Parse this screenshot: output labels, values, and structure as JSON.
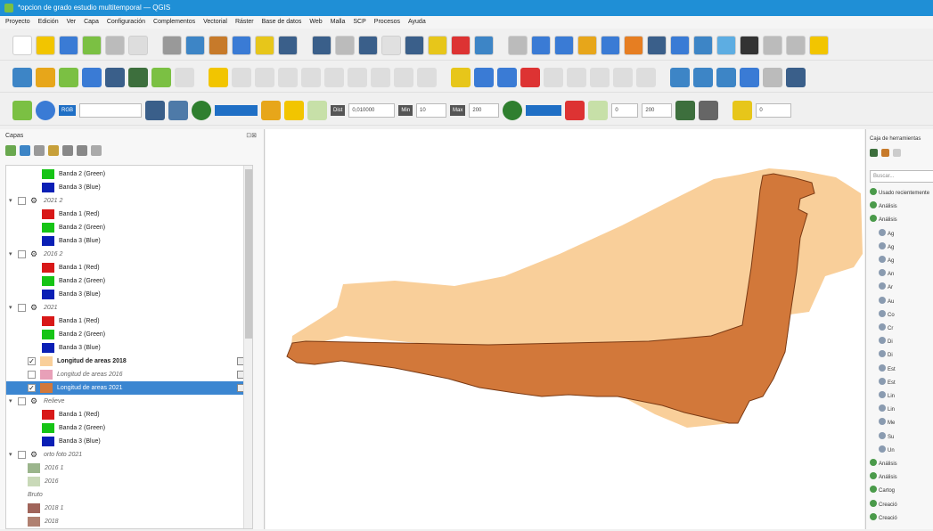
{
  "window": {
    "title": "*opcion de grado estudio multitemporal — QGIS"
  },
  "menu": [
    "Proyecto",
    "Edición",
    "Ver",
    "Capa",
    "Configuración",
    "Complementos",
    "Vectorial",
    "Ráster",
    "Base de datos",
    "Web",
    "Malla",
    "SCP",
    "Procesos",
    "Ayuda"
  ],
  "toolbar3": {
    "rgb_tag": "RGB",
    "value1": "0,010000",
    "value2": "10",
    "value3": "200",
    "value4": "0",
    "value5": "200",
    "value6": "0"
  },
  "layers_panel": {
    "title": "Capas",
    "rows": [
      {
        "type": "band",
        "label": "Banda 2 (Green)",
        "color": "#16c416"
      },
      {
        "type": "band",
        "label": "Banda 3 (Blue)",
        "color": "#0a1fb5"
      },
      {
        "type": "group",
        "label": "2021 2"
      },
      {
        "type": "band",
        "label": "Banda 1 (Red)",
        "color": "#d81818"
      },
      {
        "type": "band",
        "label": "Banda 2 (Green)",
        "color": "#16c416"
      },
      {
        "type": "band",
        "label": "Banda 3 (Blue)",
        "color": "#0a1fb5"
      },
      {
        "type": "group",
        "label": "2016 2"
      },
      {
        "type": "band",
        "label": "Banda 1 (Red)",
        "color": "#d81818"
      },
      {
        "type": "band",
        "label": "Banda 2 (Green)",
        "color": "#16c416"
      },
      {
        "type": "band",
        "label": "Banda 3 (Blue)",
        "color": "#0a1fb5"
      },
      {
        "type": "group",
        "label": "2021"
      },
      {
        "type": "band",
        "label": "Banda 1 (Red)",
        "color": "#d81818"
      },
      {
        "type": "band",
        "label": "Banda 2 (Green)",
        "color": "#16c416"
      },
      {
        "type": "band",
        "label": "Banda 3 (Blue)",
        "color": "#0a1fb5"
      },
      {
        "type": "vector",
        "label": "Longitud de areas 2018",
        "color": "#f9cf9a",
        "checked": true,
        "bold": true
      },
      {
        "type": "vector",
        "label": "Longitud de areas 2016",
        "color": "#e8a0b8",
        "checked": false,
        "italic": true
      },
      {
        "type": "vector",
        "label": "Longitud de areas 2021",
        "color": "#d2783a",
        "checked": true,
        "selected": true
      },
      {
        "type": "group",
        "label": "Relieve"
      },
      {
        "type": "band",
        "label": "Banda 1 (Red)",
        "color": "#d81818"
      },
      {
        "type": "band",
        "label": "Banda 2 (Green)",
        "color": "#16c416"
      },
      {
        "type": "band",
        "label": "Banda 3 (Blue)",
        "color": "#0a1fb5"
      },
      {
        "type": "group",
        "label": "orto foto 2021"
      },
      {
        "type": "swatch",
        "label": "2016 1",
        "color": "#9bb58c"
      },
      {
        "type": "swatch",
        "label": "2016",
        "color": "#c9d9b8"
      },
      {
        "type": "plain",
        "label": "Bruto"
      },
      {
        "type": "swatch",
        "label": "2018 1",
        "color": "#a0645a"
      },
      {
        "type": "swatch",
        "label": "2018",
        "color": "#b08070"
      }
    ]
  },
  "toolbox": {
    "title": "Caja de herramientas",
    "search_placeholder": "Buscar...",
    "items": [
      {
        "label": "Usado recientemente",
        "indent": 0
      },
      {
        "label": "Análisis",
        "indent": 0
      },
      {
        "label": "Análisis",
        "indent": 0
      },
      {
        "label": "Ag",
        "indent": 1
      },
      {
        "label": "Ag",
        "indent": 1
      },
      {
        "label": "Ag",
        "indent": 1
      },
      {
        "label": "An",
        "indent": 1
      },
      {
        "label": "Ar",
        "indent": 1
      },
      {
        "label": "Au",
        "indent": 1
      },
      {
        "label": "Co",
        "indent": 1
      },
      {
        "label": "Cr",
        "indent": 1
      },
      {
        "label": "Di",
        "indent": 1
      },
      {
        "label": "Di",
        "indent": 1
      },
      {
        "label": "Est",
        "indent": 1
      },
      {
        "label": "Est",
        "indent": 1
      },
      {
        "label": "Lin",
        "indent": 1
      },
      {
        "label": "Lin",
        "indent": 1
      },
      {
        "label": "Me",
        "indent": 1
      },
      {
        "label": "Su",
        "indent": 1
      },
      {
        "label": "Un",
        "indent": 1
      },
      {
        "label": "Análisis",
        "indent": 0
      },
      {
        "label": "Análisis",
        "indent": 0
      },
      {
        "label": "Cartog",
        "indent": 0
      },
      {
        "label": "Creació",
        "indent": 0
      },
      {
        "label": "Creació",
        "indent": 0
      }
    ]
  },
  "colors": {
    "area_2018": "#f9cf9a",
    "area_2021": "#d2783a",
    "selection": "#3b86d1",
    "titlebar": "#1f8fd6"
  }
}
